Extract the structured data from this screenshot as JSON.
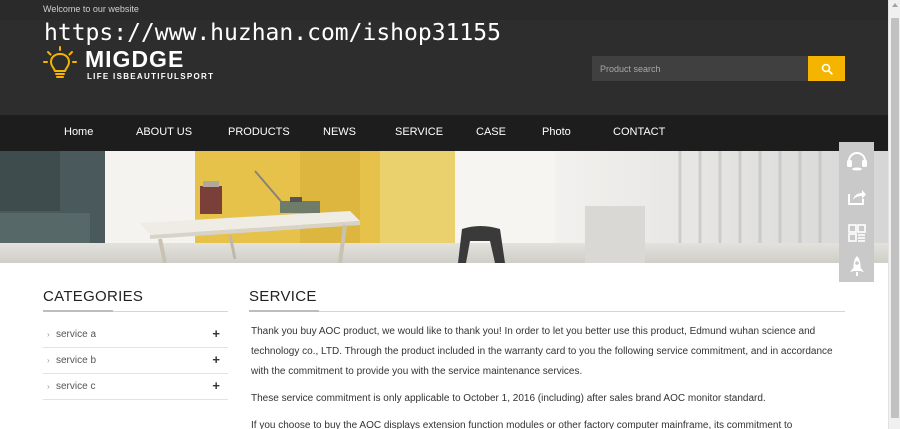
{
  "topbar": {
    "welcome": "Welcome to our website"
  },
  "watermark": "https://www.huzhan.com/ishop31155",
  "logo": {
    "brand": "MIGDGE",
    "slogan": "LIFE ISBEAUTIFULSPORT",
    "accent_color": "#f5b400"
  },
  "search": {
    "placeholder": "Product search",
    "button_icon": "search-icon"
  },
  "nav": {
    "items": [
      {
        "label": "Home"
      },
      {
        "label": "ABOUT US"
      },
      {
        "label": "PRODUCTS"
      },
      {
        "label": "NEWS"
      },
      {
        "label": "SERVICE"
      },
      {
        "label": "CASE"
      },
      {
        "label": "Photo"
      },
      {
        "label": "CONTACT"
      }
    ]
  },
  "sidetools": [
    "headset-icon",
    "share-icon",
    "qrcode-icon",
    "rocket-icon"
  ],
  "categories": {
    "title": "CATEGORIES",
    "items": [
      {
        "label": "service a",
        "toggle": "+"
      },
      {
        "label": "service b",
        "toggle": "+"
      },
      {
        "label": "service c",
        "toggle": "+"
      }
    ]
  },
  "service": {
    "title": "SERVICE",
    "paragraphs": [
      "Thank you buy AOC product, we would like to thank you! In order to let you better use this product, Edmund wuhan science and technology co., LTD. Through the product included in the warranty card to you the following service commitment, and in accordance with the commitment to provide you with the service maintenance services.",
      "These service commitment is only applicable to October 1, 2016 (including) after sales brand AOC monitor standard.",
      "If you choose to buy the AOC displays extension function modules or other factory computer mainframe, its commitment to"
    ]
  },
  "colors": {
    "header_bg": "#2d2d2d",
    "nav_bg": "#1d1d1d",
    "accent": "#f5b400"
  }
}
